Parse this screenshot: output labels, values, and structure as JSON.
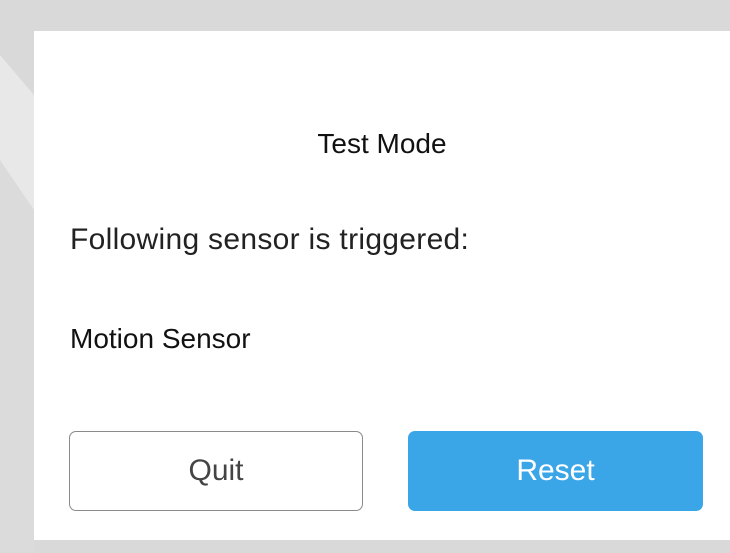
{
  "dialog": {
    "title": "Test Mode",
    "message": "Following sensor is triggered:",
    "sensor_name": "Motion Sensor",
    "quit_label": "Quit",
    "reset_label": "Reset"
  },
  "colors": {
    "background": "#d9d9d9",
    "dialog_background": "#ffffff",
    "reset_button": "#3aa6e8",
    "quit_border": "#8a8a8a"
  }
}
